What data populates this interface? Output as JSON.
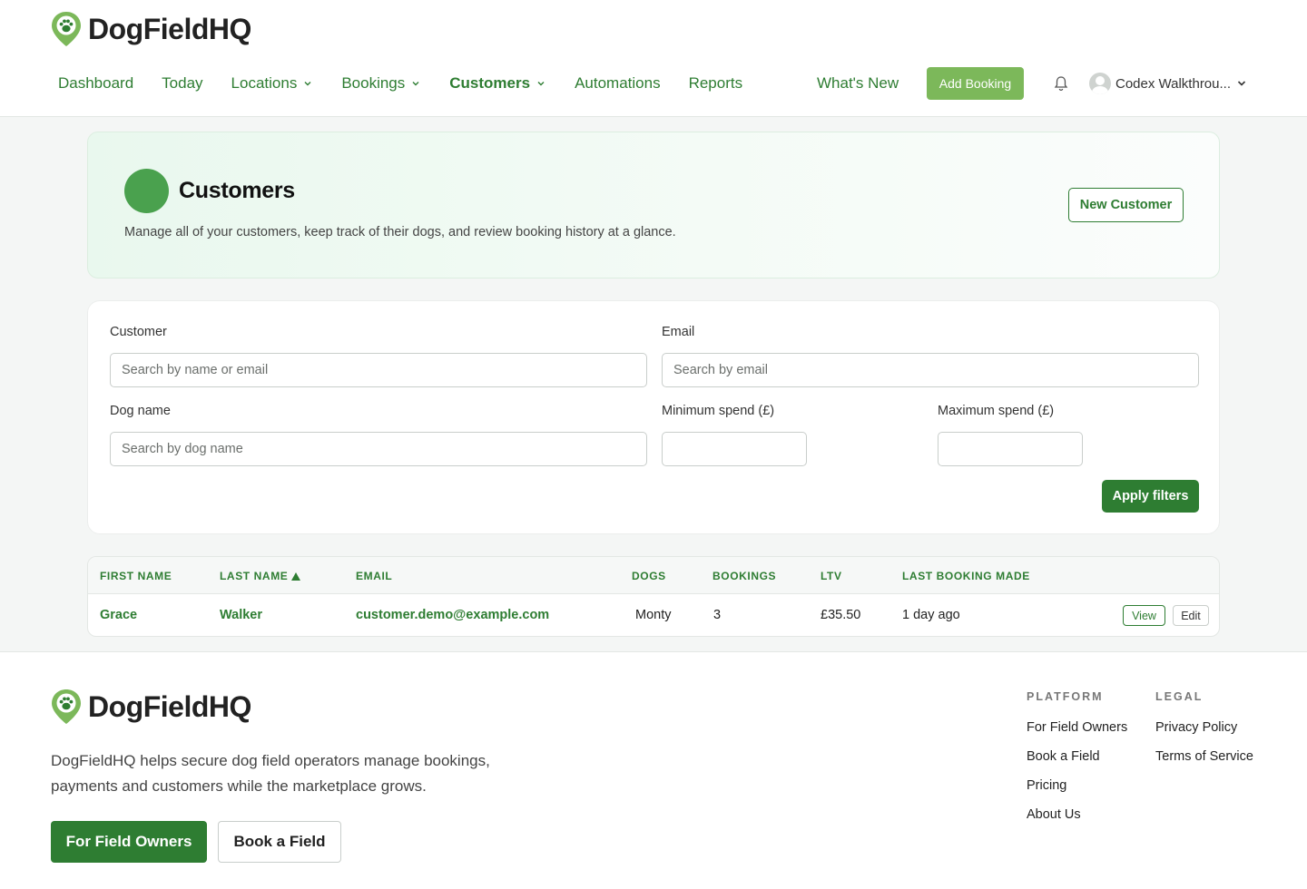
{
  "brand": {
    "name": "DogFieldHQ",
    "logo_icon": "paw-pin-icon",
    "brand_color": "#2e7d32",
    "accent_color": "#7cb85a"
  },
  "nav": {
    "items": [
      {
        "label": "Dashboard",
        "dropdown": false
      },
      {
        "label": "Today",
        "dropdown": false
      },
      {
        "label": "Locations",
        "dropdown": true
      },
      {
        "label": "Bookings",
        "dropdown": true
      },
      {
        "label": "Customers",
        "dropdown": true,
        "active": true
      },
      {
        "label": "Automations",
        "dropdown": false
      },
      {
        "label": "Reports",
        "dropdown": false
      }
    ],
    "whats_new": "What's New",
    "add_booking": "Add Booking",
    "user_name": "Codex Walkthrou..."
  },
  "hero": {
    "title": "Customers",
    "description": "Manage all of your customers, keep track of their dogs, and review booking history at a glance.",
    "new_customer": "New Customer"
  },
  "filters": {
    "customer_label": "Customer",
    "customer_placeholder": "Search by name or email",
    "email_label": "Email",
    "email_placeholder": "Search by email",
    "dog_label": "Dog name",
    "dog_placeholder": "Search by dog name",
    "min_spend_label": "Minimum spend (£)",
    "max_spend_label": "Maximum spend (£)",
    "apply": "Apply filters"
  },
  "table": {
    "headers": {
      "first_name": "FIRST NAME",
      "last_name": "LAST NAME",
      "email": "EMAIL",
      "dogs": "DOGS",
      "bookings": "BOOKINGS",
      "ltv": "LTV",
      "last_booking": "LAST BOOKING MADE"
    },
    "sorted_by": "last_name",
    "sort_direction": "ascending",
    "rows": [
      {
        "first_name": "Grace",
        "last_name": "Walker",
        "email": "customer.demo@example.com",
        "dogs": "Monty",
        "bookings": "3",
        "ltv": "£35.50",
        "last_booking": "1 day ago",
        "view": "View",
        "edit": "Edit"
      }
    ]
  },
  "footer": {
    "description": "DogFieldHQ helps secure dog field operators manage bookings, payments and customers while the marketplace grows.",
    "cta_owners": "For Field Owners",
    "cta_book": "Book a Field",
    "platform": {
      "heading": "PLATFORM",
      "links": [
        "For Field Owners",
        "Book a Field",
        "Pricing",
        "About Us"
      ]
    },
    "legal": {
      "heading": "LEGAL",
      "links": [
        "Privacy Policy",
        "Terms of Service"
      ]
    }
  }
}
